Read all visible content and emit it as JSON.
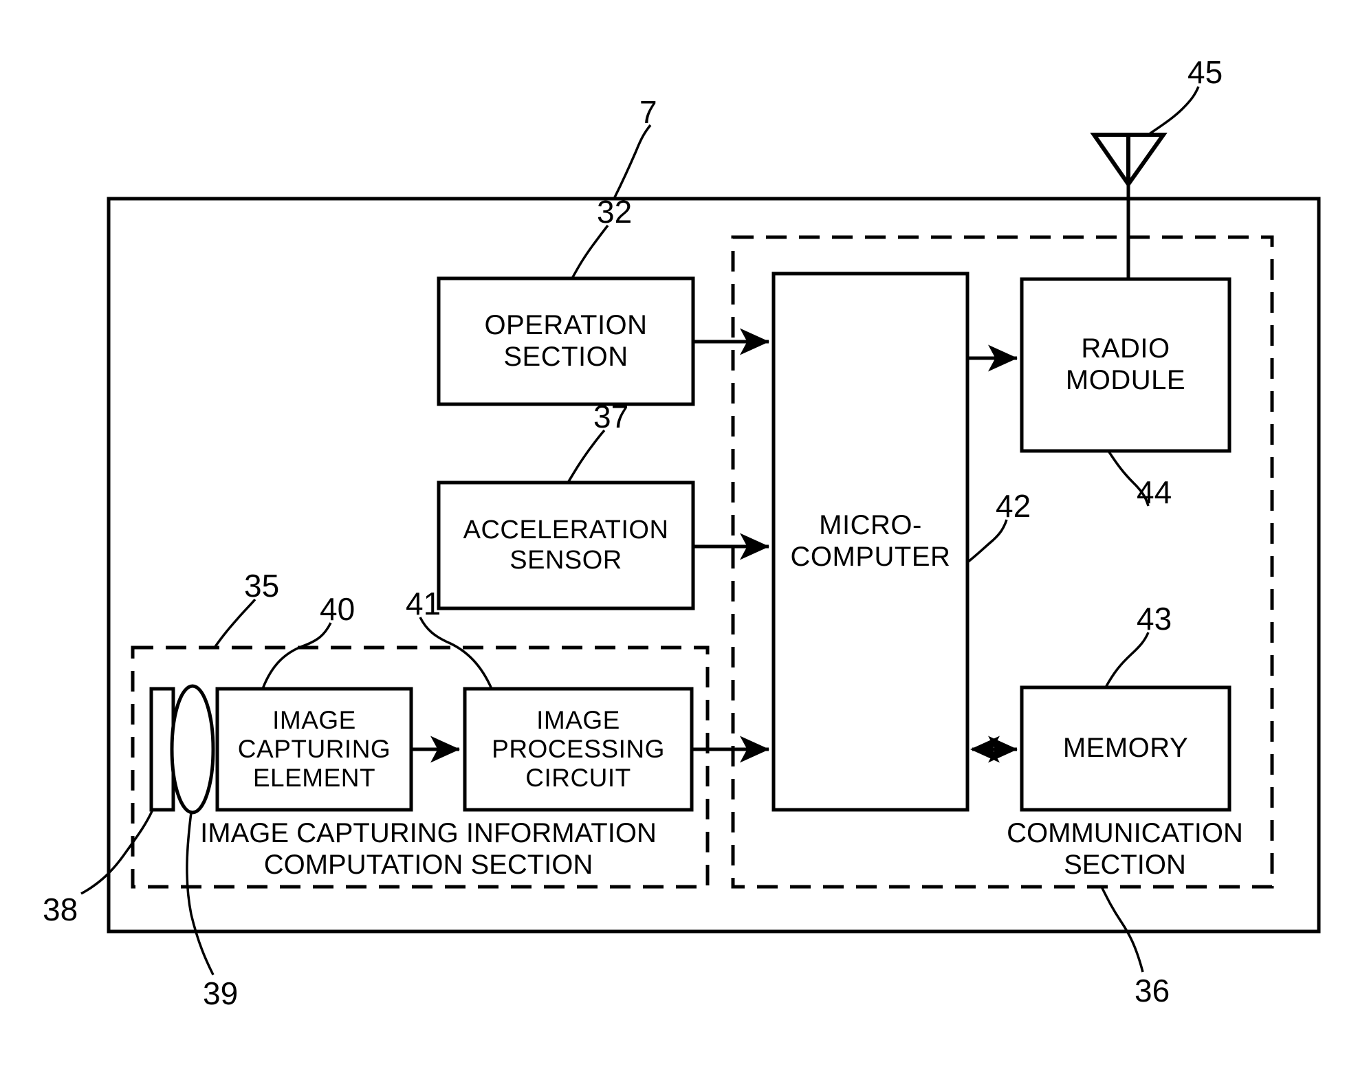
{
  "figure": {
    "title": "Image capturing controller block diagram",
    "stroke_color": "#000000",
    "background_color": "#ffffff"
  },
  "blocks": [
    {
      "id": "operation_section",
      "label": "OPERATION\nSECTION",
      "ref": "32"
    },
    {
      "id": "acceleration_sensor",
      "label": "ACCELERATION\nSENSOR",
      "ref": "37"
    },
    {
      "id": "image_capturing_element",
      "label": "IMAGE\nCAPTURING\nELEMENT",
      "ref": "40"
    },
    {
      "id": "image_processing_circuit",
      "label": "IMAGE\nPROCESSING\nCIRCUIT",
      "ref": "41"
    },
    {
      "id": "microcomputer",
      "label": "MICRO-\nCOMPUTER",
      "ref": "42"
    },
    {
      "id": "radio_module",
      "label": "RADIO\nMODULE",
      "ref": "44"
    },
    {
      "id": "memory",
      "label": "MEMORY",
      "ref": "43"
    }
  ],
  "sections": [
    {
      "id": "image_capturing_information_computation_section",
      "caption": "IMAGE CAPTURING INFORMATION\nCOMPUTATION SECTION",
      "ref": "35",
      "style": "dashed"
    },
    {
      "id": "communication_section",
      "caption": "COMMUNICATION\nSECTION",
      "ref": "36",
      "style": "dashed"
    }
  ],
  "outer_housing": {
    "id": "controller_housing",
    "ref": "7",
    "style": "solid"
  },
  "components": [
    {
      "id": "antenna",
      "ref": "45",
      "shape": "triangle"
    },
    {
      "id": "infrared_filter",
      "ref": "38",
      "shape": "rectangle"
    },
    {
      "id": "lens",
      "ref": "39",
      "shape": "ellipse"
    }
  ],
  "reference_numerals": {
    "n7": "7",
    "n32": "32",
    "n35": "35",
    "n36": "36",
    "n37": "37",
    "n38": "38",
    "n39": "39",
    "n40": "40",
    "n41": "41",
    "n42": "42",
    "n43": "43",
    "n44": "44",
    "n45": "45"
  },
  "labels": {
    "operation_section": "OPERATION\nSECTION",
    "acceleration_sensor": "ACCELERATION\nSENSOR",
    "image_capturing_element": "IMAGE\nCAPTURING\nELEMENT",
    "image_processing_circuit": "IMAGE\nPROCESSING\nCIRCUIT",
    "microcomputer": "MICRO-\nCOMPUTER",
    "radio_module": "RADIO\nMODULE",
    "memory": "MEMORY",
    "image_capturing_caption": "IMAGE CAPTURING INFORMATION\nCOMPUTATION SECTION",
    "communication_caption": "COMMUNICATION\nSECTION"
  },
  "connections": [
    {
      "from": "operation_section",
      "to": "microcomputer",
      "arrow": "single"
    },
    {
      "from": "acceleration_sensor",
      "to": "microcomputer",
      "arrow": "single"
    },
    {
      "from": "image_capturing_element",
      "to": "image_processing_circuit",
      "arrow": "single"
    },
    {
      "from": "image_processing_circuit",
      "to": "microcomputer",
      "arrow": "single"
    },
    {
      "from": "microcomputer",
      "to": "radio_module",
      "arrow": "single"
    },
    {
      "from": "microcomputer",
      "to": "memory",
      "arrow": "double"
    },
    {
      "from": "radio_module",
      "to": "antenna",
      "arrow": "none"
    }
  ]
}
